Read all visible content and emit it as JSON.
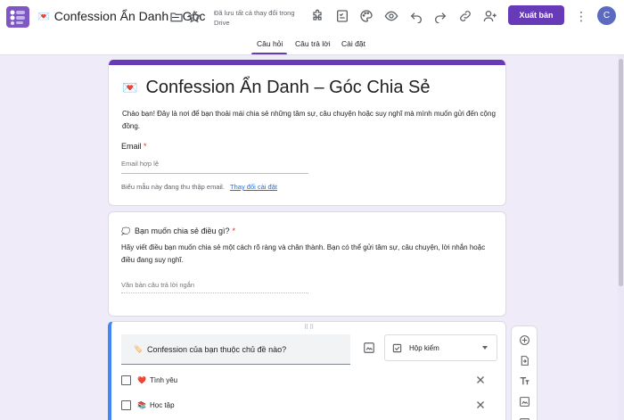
{
  "header": {
    "doc_title": "Confession Ẩn Danh – Góc",
    "doc_title_emoji": "💌",
    "saved_status": "Đã lưu tất cả thay đổi trong Drive",
    "publish_label": "Xuất bản",
    "avatar_initial": "C",
    "icons": [
      "forms-logo-icon",
      "folder-icon",
      "star-icon",
      "addon-icon",
      "checklist-icon",
      "palette-icon",
      "preview-eye-icon",
      "undo-icon",
      "redo-icon",
      "link-icon",
      "add-collaborator-icon",
      "more-vert-icon"
    ]
  },
  "tabs": [
    {
      "label": "Câu hỏi",
      "active": true
    },
    {
      "label": "Câu trả lời",
      "active": false
    },
    {
      "label": "Cài đặt",
      "active": false
    }
  ],
  "form": {
    "title_emoji": "💌",
    "title": "Confession Ẩn Danh – Góc Chia Sẻ",
    "description": "Chào bạn! Đây là nơi để bạn thoải mái chia sẻ những tâm sự, câu chuyện hoặc suy nghĩ mà mình muốn gửi đến cộng đồng.",
    "email": {
      "label": "Email",
      "required_mark": "*",
      "placeholder": "Email hợp lệ",
      "collect_note": "Biểu mẫu này đang thu thập email.",
      "change_link": "Thay đổi cài đặt"
    }
  },
  "questions": [
    {
      "emoji": "💭",
      "title": "Bạn muốn chia sẻ điều gì?",
      "required_mark": "*",
      "description": "Hãy viết điều bạn muốn chia sẻ một cách rõ ràng và chân thành. Bạn có thể gửi tâm sự, câu chuyện, lời nhắn hoặc điều đang suy nghĩ.",
      "answer_placeholder": "Văn bản câu trả lời ngắn"
    },
    {
      "emoji": "🏷️",
      "title": "Confession của bạn thuộc chủ đề nào?",
      "type_label": "Hộp kiểm",
      "options": [
        {
          "emoji": "❤️",
          "label": "Tình yêu"
        },
        {
          "emoji": "📚",
          "label": "Học tập"
        }
      ]
    }
  ],
  "colors": {
    "accent": "#673ab7",
    "background": "#f0ebf8",
    "active_border": "#4285f4",
    "required": "#d93025",
    "link": "#1a73e8"
  }
}
